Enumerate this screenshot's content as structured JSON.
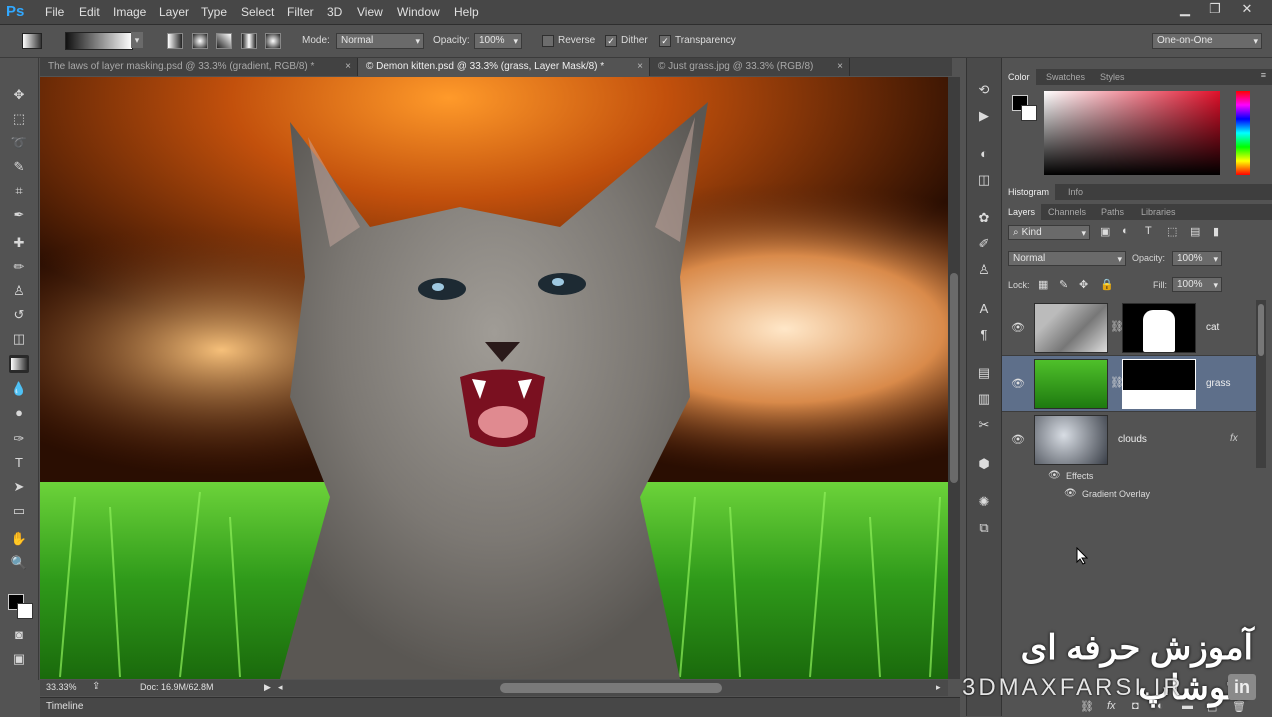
{
  "app": {
    "logo": "Ps"
  },
  "menu": [
    "File",
    "Edit",
    "Image",
    "Layer",
    "Type",
    "Select",
    "Filter",
    "3D",
    "View",
    "Window",
    "Help"
  ],
  "window_buttons": {
    "minimize": "▁",
    "restore": "❐",
    "close": "✕"
  },
  "options": {
    "mode_label": "Mode:",
    "mode_value": "Normal",
    "opacity_label": "Opacity:",
    "opacity_value": "100%",
    "reverse_label": "Reverse",
    "dither_label": "Dither",
    "transparency_label": "Transparency",
    "workspace": "One-on-One"
  },
  "tabs": [
    {
      "label": "The laws of layer masking.psd @ 33.3% (gradient, RGB/8) *",
      "close": "×"
    },
    {
      "label": "© Demon kitten.psd @ 33.3% (grass, Layer Mask/8) *",
      "close": "×"
    },
    {
      "label": "© Just grass.jpg @ 33.3% (RGB/8)",
      "close": "×"
    }
  ],
  "status": {
    "zoom": "33.33%",
    "doc": "Doc: 16.9M/62.8M"
  },
  "timeline_label": "Timeline",
  "panels": {
    "color_tabs": [
      "Color",
      "Swatches",
      "Styles"
    ],
    "histogram_tabs": [
      "Histogram",
      "Info"
    ],
    "layers_tabs": [
      "Layers",
      "Channels",
      "Paths",
      "Libraries"
    ],
    "kind_label": "Kind",
    "blend_mode": "Normal",
    "opacity_label": "Opacity:",
    "opacity_value": "100%",
    "lock_label": "Lock:",
    "fill_label": "Fill:",
    "fill_value": "100%"
  },
  "layers": [
    {
      "name": "cat"
    },
    {
      "name": "grass"
    },
    {
      "name": "clouds",
      "fx": "fx"
    }
  ],
  "effects": {
    "label": "Effects",
    "item": "Gradient Overlay"
  },
  "watermark": {
    "persian": "آموزش حرفه ای فتوشاپ",
    "site": "3DMAXFARSI.IR",
    "badge": "in"
  },
  "colors": {
    "accent": "#31a8ff",
    "selected_layer": "#5e6f8a"
  }
}
